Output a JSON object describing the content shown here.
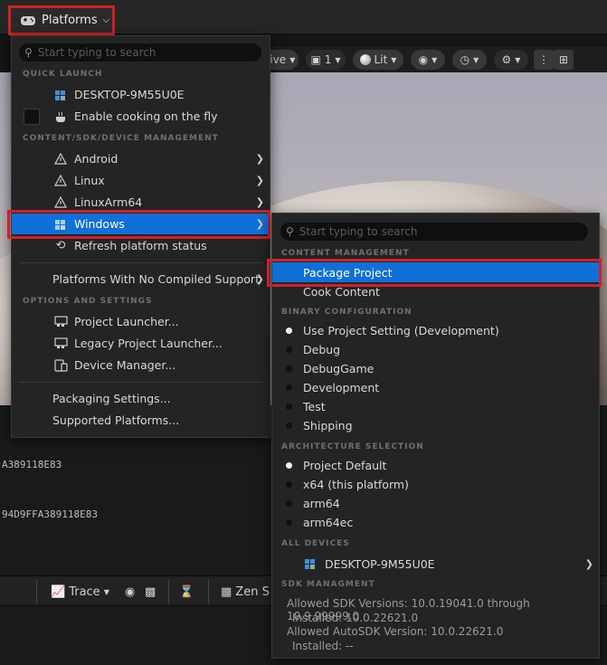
{
  "toolbar": {
    "platforms_label": "Platforms",
    "view_mode_partial": "tive",
    "camera_speed": "1",
    "lit_label": "Lit"
  },
  "log": {
    "line1": "A389118E83",
    "line2": "94D9FFA389118E83"
  },
  "bottombar": {
    "trace_label": "Trace",
    "zen_label": "Zen S"
  },
  "platforms_menu": {
    "search_placeholder": "Start typing to search",
    "quick_launch_header": "QUICK LAUNCH",
    "device_name": "DESKTOP-9M55U0E",
    "enable_cooking": "Enable cooking on the fly",
    "content_sdk_header": "CONTENT/SDK/DEVICE MANAGEMENT",
    "platforms": [
      "Android",
      "Linux",
      "LinuxArm64",
      "Windows"
    ],
    "refresh": "Refresh platform status",
    "no_compiled": "Platforms With No Compiled Support",
    "options_header": "OPTIONS AND SETTINGS",
    "project_launcher": "Project Launcher...",
    "legacy_launcher": "Legacy Project Launcher...",
    "device_manager": "Device Manager...",
    "packaging_settings": "Packaging Settings...",
    "supported_platforms": "Supported Platforms..."
  },
  "windows_menu": {
    "search_placeholder": "Start typing to search",
    "content_header": "CONTENT MANAGEMENT",
    "package_project": "Package Project",
    "cook_content": "Cook Content",
    "binary_header": "BINARY CONFIGURATION",
    "binary_options": [
      "Use Project Setting (Development)",
      "Debug",
      "DebugGame",
      "Development",
      "Test",
      "Shipping"
    ],
    "arch_header": "ARCHITECTURE SELECTION",
    "arch_options": [
      "Project Default",
      "x64 (this platform)",
      "arm64",
      "arm64ec"
    ],
    "all_devices_header": "ALL DEVICES",
    "device_name": "DESKTOP-9M55U0E",
    "sdk_header": "SDK MANAGMENT",
    "sdk_allowed": "Allowed SDK Versions: 10.0.19041.0 through 10.9.99999.0",
    "sdk_installed": "Installed: 10.0.22621.0",
    "autosdk_allowed": "Allowed AutoSDK Version: 10.0.22621.0",
    "autosdk_installed": "Installed: --"
  },
  "colors": {
    "selection": "#0f70d7",
    "highlight_outline": "#d0202a",
    "menu_bg": "#242424"
  }
}
